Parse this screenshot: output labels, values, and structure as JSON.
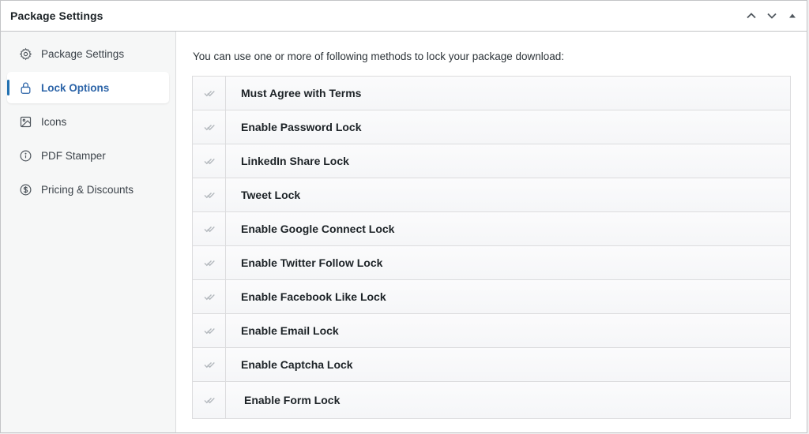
{
  "panel": {
    "title": "Package Settings"
  },
  "header_controls": [
    {
      "name": "move-up-icon",
      "glyph": "chevron-up"
    },
    {
      "name": "move-down-icon",
      "glyph": "chevron-down"
    },
    {
      "name": "toggle-panel-icon",
      "glyph": "triangle-up"
    }
  ],
  "sidebar": {
    "items": [
      {
        "label": "Package Settings",
        "icon": "gear-icon",
        "active": false
      },
      {
        "label": "Lock Options",
        "icon": "lock-icon",
        "active": true
      },
      {
        "label": "Icons",
        "icon": "image-icon",
        "active": false
      },
      {
        "label": "PDF Stamper",
        "icon": "info-icon",
        "active": false
      },
      {
        "label": "Pricing & Discounts",
        "icon": "dollar-circle-icon",
        "active": false
      }
    ]
  },
  "main": {
    "intro": "You can use one or more of following methods to lock your package download:",
    "options": [
      {
        "label": "Must Agree with Terms",
        "checked": false
      },
      {
        "label": "Enable Password Lock",
        "checked": false
      },
      {
        "label": "LinkedIn Share Lock",
        "checked": false
      },
      {
        "label": "Tweet Lock",
        "checked": false
      },
      {
        "label": "Enable Google Connect Lock",
        "checked": false
      },
      {
        "label": "Enable Twitter Follow Lock",
        "checked": false
      },
      {
        "label": "Enable Facebook Like Lock",
        "checked": false
      },
      {
        "label": "Enable Email Lock",
        "checked": false
      },
      {
        "label": "Enable Captcha Lock",
        "checked": false
      },
      {
        "label": "Enable Form Lock",
        "checked": false
      }
    ]
  },
  "colors": {
    "accent": "#2271b1",
    "active_label": "#2c64a8",
    "border": "#c3c4c7",
    "sidebar_bg": "#f6f7f7",
    "check_icon": "#b4b9be"
  }
}
